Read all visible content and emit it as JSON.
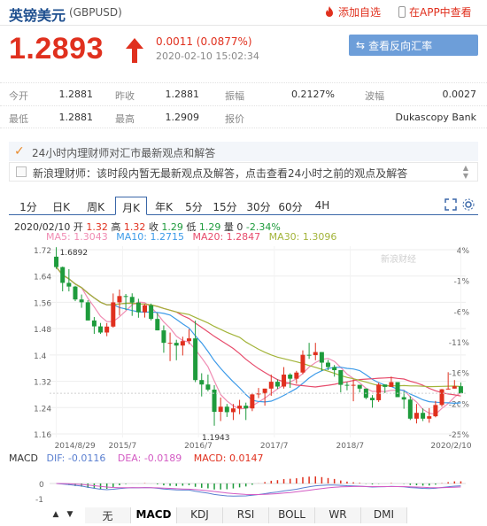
{
  "header": {
    "name": "英镑美元",
    "code": "(GBPUSD)",
    "add_watch": "添加自选",
    "open_app": "在APP中查看",
    "accent": "#e0301e"
  },
  "quote": {
    "price": "1.2893",
    "change": "0.0011 (0.0877%)",
    "time": "2020-02-10 15:02:34",
    "reverse_button": "查看反向汇率",
    "rows": [
      [
        {
          "label": "今开",
          "value": "1.2881"
        },
        {
          "label": "昨收",
          "value": "1.2881"
        },
        {
          "label": "振幅",
          "value": "0.2127%"
        },
        {
          "label": "波幅",
          "value": "0.0027"
        }
      ],
      [
        {
          "label": "最低",
          "value": "1.2881"
        },
        {
          "label": "最高",
          "value": "1.2909"
        },
        {
          "label": "报价",
          "value": ""
        },
        {
          "label": "",
          "value": "Dukascopy Bank"
        }
      ]
    ]
  },
  "analyst": {
    "title": "24小时内理财师对汇市最新观点和解答",
    "body": "新浪理财师：该时段内暂无最新观点及解答，点击查看24小时之前的观点及解答"
  },
  "chart_tabs": [
    "1分",
    "日K",
    "周K",
    "月K",
    "年K",
    "5分",
    "15分",
    "30分",
    "60分",
    "4H"
  ],
  "active_tab": "月K",
  "ohlc": {
    "date": "2020/02/10",
    "open_label": "开",
    "open": "1.32",
    "high_label": "高",
    "high": "1.32",
    "close_label": "收",
    "close": "1.29",
    "low_label": "低",
    "low": "1.29",
    "vol_label": "量",
    "vol": "0",
    "pct": "-2.34%"
  },
  "ma": {
    "ma5_label": "MA5:",
    "ma5": "1.3043",
    "ma5_color": "#f08cb3",
    "ma10_label": "MA10:",
    "ma10": "1.2715",
    "ma10_color": "#3d9be9",
    "ma20_label": "MA20:",
    "ma20": "1.2847",
    "ma20_color": "#e74c6c",
    "ma30_label": "MA30:",
    "ma30": "1.3096",
    "ma30_color": "#a3b43a"
  },
  "chart_data": {
    "type": "candlestick",
    "y_ticks": [
      "1.72",
      "1.64",
      "1.56",
      "1.48",
      "1.4",
      "1.32",
      "1.24",
      "1.16"
    ],
    "y_range": [
      1.16,
      1.72
    ],
    "pct_ticks": [
      "4%",
      "-1%",
      "-6%",
      "-11%",
      "-16%",
      "-20%",
      "-25%"
    ],
    "x_ticks": [
      "2014/8/29",
      "2015/7",
      "2016/7",
      "2017/7",
      "2018/7",
      "2020/2/10"
    ],
    "high_label": "1.6892",
    "low_label": "1.1943",
    "watermark": "新浪财经",
    "up_color": "#e0301e",
    "down_color": "#1e9b3c",
    "candles": [
      [
        1.6892,
        1.7169,
        1.6535,
        1.6588
      ],
      [
        1.6588,
        1.6602,
        1.5878,
        1.6126
      ],
      [
        1.6126,
        1.6526,
        1.5876,
        1.6017
      ],
      [
        1.6017,
        1.6041,
        1.5591,
        1.564
      ],
      [
        1.564,
        1.5785,
        1.5396,
        1.5557
      ],
      [
        1.5557,
        1.562,
        1.5035,
        1.5025
      ],
      [
        1.5025,
        1.5125,
        1.4633,
        1.4852
      ],
      [
        1.4852,
        1.4952,
        1.4633,
        1.4672
      ],
      [
        1.4672,
        1.495,
        1.4564,
        1.4846
      ],
      [
        1.4846,
        1.5815,
        1.4816,
        1.5555
      ],
      [
        1.5555,
        1.593,
        1.517,
        1.574
      ],
      [
        1.574,
        1.58,
        1.533,
        1.5715
      ],
      [
        1.5715,
        1.582,
        1.516,
        1.5549
      ],
      [
        1.5549,
        1.566,
        1.5105,
        1.5265
      ],
      [
        1.5265,
        1.55,
        1.511,
        1.547
      ],
      [
        1.547,
        1.552,
        1.5025,
        1.507
      ],
      [
        1.507,
        1.5245,
        1.4895,
        1.4735
      ],
      [
        1.4735,
        1.488,
        1.408,
        1.437
      ],
      [
        1.437,
        1.467,
        1.3835,
        1.437
      ],
      [
        1.437,
        1.446,
        1.386,
        1.429
      ],
      [
        1.429,
        1.455,
        1.4,
        1.442
      ],
      [
        1.442,
        1.477,
        1.433,
        1.45
      ],
      [
        1.45,
        1.502,
        1.322,
        1.328
      ],
      [
        1.328,
        1.348,
        1.28,
        1.315
      ],
      [
        1.315,
        1.344,
        1.295,
        1.3
      ],
      [
        1.3,
        1.313,
        1.1943,
        1.235
      ],
      [
        1.235,
        1.277,
        1.208,
        1.25
      ],
      [
        1.25,
        1.258,
        1.22,
        1.234
      ],
      [
        1.234,
        1.258,
        1.211,
        1.245
      ],
      [
        1.245,
        1.27,
        1.228,
        1.253
      ],
      [
        1.253,
        1.262,
        1.211,
        1.245
      ],
      [
        1.245,
        1.29,
        1.237,
        1.286
      ],
      [
        1.286,
        1.305,
        1.275,
        1.289
      ],
      [
        1.289,
        1.302,
        1.253,
        1.303
      ],
      [
        1.303,
        1.344,
        1.282,
        1.323
      ],
      [
        1.323,
        1.33,
        1.302,
        1.309
      ],
      [
        1.309,
        1.366,
        1.303,
        1.344
      ],
      [
        1.344,
        1.348,
        1.305,
        1.332
      ],
      [
        1.332,
        1.355,
        1.317,
        1.35
      ],
      [
        1.35,
        1.415,
        1.345,
        1.402
      ],
      [
        1.402,
        1.437,
        1.39,
        1.401
      ],
      [
        1.401,
        1.437,
        1.386,
        1.41
      ],
      [
        1.41,
        1.399,
        1.355,
        1.379
      ],
      [
        1.379,
        1.387,
        1.357,
        1.366
      ],
      [
        1.366,
        1.372,
        1.338,
        1.357
      ],
      [
        1.357,
        1.344,
        1.292,
        1.314
      ],
      [
        1.314,
        1.322,
        1.298,
        1.312
      ],
      [
        1.312,
        1.33,
        1.266,
        1.314
      ],
      [
        1.314,
        1.308,
        1.292,
        1.303
      ],
      [
        1.303,
        1.3,
        1.272,
        1.276
      ],
      [
        1.276,
        1.284,
        1.247,
        1.269
      ],
      [
        1.269,
        1.32,
        1.264,
        1.315
      ],
      [
        1.315,
        1.309,
        1.29,
        1.308
      ],
      [
        1.308,
        1.338,
        1.308,
        1.322
      ],
      [
        1.322,
        1.317,
        1.278,
        1.278
      ],
      [
        1.278,
        1.295,
        1.244,
        1.271
      ],
      [
        1.271,
        1.281,
        1.211,
        1.215
      ],
      [
        1.215,
        1.258,
        1.201,
        1.232
      ],
      [
        1.232,
        1.245,
        1.208,
        1.215
      ],
      [
        1.215,
        1.246,
        1.203,
        1.222
      ],
      [
        1.222,
        1.267,
        1.219,
        1.255
      ],
      [
        1.255,
        1.302,
        1.25,
        1.301
      ],
      [
        1.301,
        1.351,
        1.3,
        1.303
      ],
      [
        1.303,
        1.328,
        1.31
      ],
      [
        1.31,
        1.321,
        1.289,
        1.2893
      ]
    ],
    "macd": {
      "dif_label": "DIF:",
      "dif": "-0.0116",
      "dea_label": "DEA:",
      "dea": "-0.0189",
      "macd_label": "MACD:",
      "macd": "0.0147",
      "y_ticks": [
        "0",
        "-1"
      ]
    }
  },
  "indicator_tabs": [
    "无",
    "MACD",
    "KDJ",
    "RSI",
    "BOLL",
    "WR",
    "DMI"
  ],
  "active_indicator": "MACD",
  "nav_left": "▲",
  "nav_right": "▼"
}
